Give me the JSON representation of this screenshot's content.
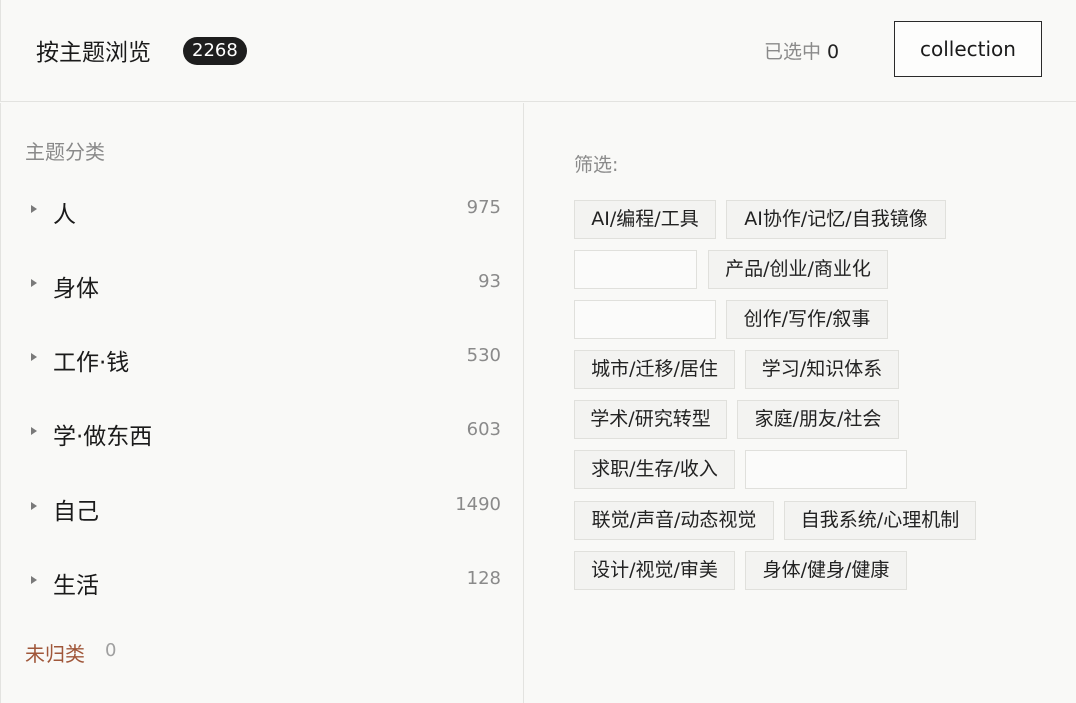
{
  "header": {
    "title": "按主题浏览",
    "total_count": "2268",
    "selected_label": "已选中",
    "selected_count": "0",
    "collection_button": "collection"
  },
  "sidebar": {
    "heading": "主题分类",
    "categories": [
      {
        "label": "人",
        "count": "975"
      },
      {
        "label": "身体",
        "count": "93"
      },
      {
        "label": "工作·钱",
        "count": "530"
      },
      {
        "label": "学·做东西",
        "count": "603"
      },
      {
        "label": "自己",
        "count": "1490"
      },
      {
        "label": "生活",
        "count": "128"
      }
    ],
    "uncategorized_label": "未归类",
    "uncategorized_count": "0"
  },
  "filter": {
    "label": "筛选:",
    "tags": [
      "AI/编程/工具",
      "AI协作/记忆/自我镜像",
      "",
      "产品/创业/商业化",
      "",
      "创作/写作/叙事",
      "城市/迁移/居住",
      "学习/知识体系",
      "学术/研究转型",
      "家庭/朋友/社会",
      "求职/生存/收入",
      "",
      "联觉/声音/动态视觉",
      "自我系统/心理机制",
      "设计/视觉/审美",
      "身体/健身/健康"
    ]
  }
}
